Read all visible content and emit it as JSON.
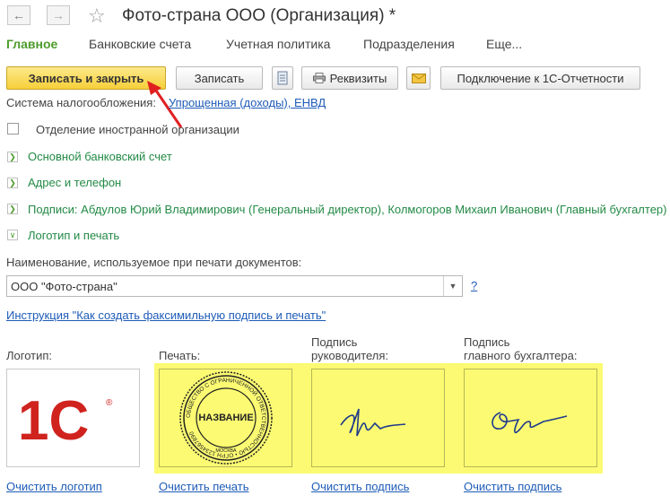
{
  "header": {
    "title": "Фото-страна ООО (Организация)",
    "modified_mark": "*",
    "back_icon": "arrow-left-icon",
    "forward_icon": "arrow-right-icon",
    "favorite_icon": "star-icon"
  },
  "menu": {
    "items": [
      "Главное",
      "Банковские счета",
      "Учетная политика",
      "Подразделения",
      "Еще..."
    ],
    "active_color": "#4d9c2b"
  },
  "toolbar": {
    "save_close": "Записать и закрыть",
    "save": "Записать",
    "requisites": "Реквизиты",
    "connect": "Подключение к 1С-Отчетности"
  },
  "tax": {
    "label": "Система налогообложения:",
    "value": "Упрощенная (доходы), ЕНВД"
  },
  "foreign_branch": {
    "label": "Отделение иностранной организации",
    "checked": false
  },
  "sections": {
    "bank": "Основной банковский счет",
    "address": "Адрес и телефон",
    "signatures": "Подписи: Абдулов Юрий Владимирович (Генеральный директор), Колмогоров Михаил Иванович (Главный бухгалтер)",
    "logo": "Логотип и печать"
  },
  "print_name": {
    "label": "Наименование, используемое при печати документов:",
    "value": "ООО \"Фото-страна\"",
    "help": "?"
  },
  "instruction_link": "Инструкция \"Как создать факсимильную подпись и печать\"",
  "images": {
    "logo_label": "Логотип:",
    "stamp_label": "Печать:",
    "director_label_1": "Подпись",
    "director_label_2": "руководителя:",
    "accountant_label_1": "Подпись",
    "accountant_label_2": "главного бухгалтера:",
    "logo_text": "1С",
    "stamp_text": "НАЗВАНИЕ",
    "stamp_city": "МОСКВА",
    "stamp_ring": "ОБЩЕСТВО С ОГРАНИЧЕННОЙ ОТВЕТСТВЕННОСТЬЮ • ОГРН 1234567890",
    "clear_logo": "Очистить логотип",
    "clear_stamp": "Очистить печать",
    "clear_director": "Очистить подпись",
    "clear_accountant": "Очистить подпись"
  },
  "colors": {
    "logo_red": "#d0231e",
    "highlight": "#fbfa72",
    "annotation_arrow": "#e02020",
    "link": "#1e5bb7"
  }
}
